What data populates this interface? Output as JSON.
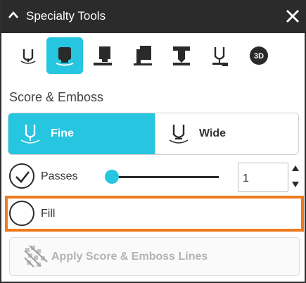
{
  "window": {
    "title": "Specialty Tools",
    "collapse_icon": "chevron-up-icon",
    "close_icon": "close-icon"
  },
  "toolbar": {
    "tools": [
      {
        "icon": "score-tool-icon",
        "active": false
      },
      {
        "icon": "emboss-tool-icon",
        "active": true
      },
      {
        "icon": "stamp-tool-icon",
        "active": false
      },
      {
        "icon": "stamp-stack-tool-icon",
        "active": false
      },
      {
        "icon": "punch-tool-icon",
        "active": false
      },
      {
        "icon": "emboss-stylus-tool-icon",
        "active": false
      },
      {
        "icon": "3d-tool-icon",
        "active": false
      }
    ],
    "badge_3d": "3D"
  },
  "section": {
    "title": "Score & Emboss"
  },
  "tip_selector": {
    "fine_label": "Fine",
    "wide_label": "Wide",
    "selected": "Fine"
  },
  "passes": {
    "label": "Passes",
    "checked": true,
    "value": "1",
    "slider_fraction": 0
  },
  "fill": {
    "label": "Fill",
    "checked": false
  },
  "apply": {
    "label": "Apply Score & Emboss Lines",
    "enabled": false
  },
  "colors": {
    "accent": "#26c5e0",
    "titlebar": "#2b2b2b",
    "highlight": "#f07a1e",
    "disabled_text": "#b3b3b3"
  }
}
